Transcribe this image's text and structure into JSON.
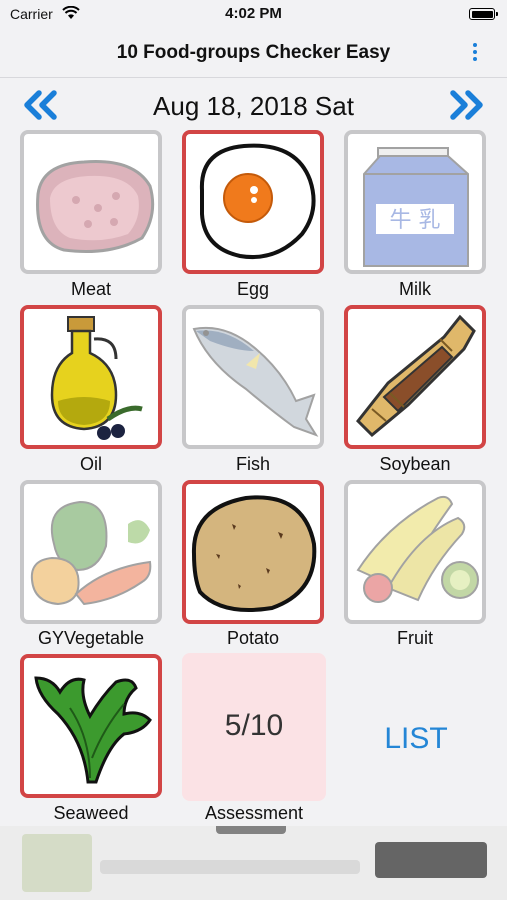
{
  "status": {
    "carrier": "Carrier",
    "time": "4:02 PM"
  },
  "nav": {
    "title": "10 Food-groups Checker Easy",
    "menu_icon": "more-vertical-icon"
  },
  "date": {
    "label": "Aug 18, 2018 Sat",
    "prev_icon": "double-chevron-left-icon",
    "next_icon": "double-chevron-right-icon"
  },
  "foods": [
    {
      "label": "Meat",
      "checked": false,
      "icon": "meat-icon"
    },
    {
      "label": "Egg",
      "checked": true,
      "icon": "egg-icon"
    },
    {
      "label": "Milk",
      "checked": false,
      "icon": "milk-carton-icon"
    },
    {
      "label": "Oil",
      "checked": true,
      "icon": "oil-bottle-icon"
    },
    {
      "label": "Fish",
      "checked": false,
      "icon": "fish-icon"
    },
    {
      "label": "Soybean",
      "checked": true,
      "icon": "natto-icon"
    },
    {
      "label": "GYVegetable",
      "checked": false,
      "icon": "vegetables-icon"
    },
    {
      "label": "Potato",
      "checked": true,
      "icon": "potato-icon"
    },
    {
      "label": "Fruit",
      "checked": false,
      "icon": "fruit-icon"
    },
    {
      "label": "Seaweed",
      "checked": true,
      "icon": "seaweed-icon"
    }
  ],
  "assessment": {
    "value": "5/10",
    "label": "Assessment"
  },
  "list_button": "LIST",
  "milk_carton_text": "牛 乳",
  "colors": {
    "accent": "#1a7fd9",
    "checked_border": "#d24545",
    "unchecked_border": "#c7c7c9",
    "assessment_bg": "#fbe2e5"
  }
}
